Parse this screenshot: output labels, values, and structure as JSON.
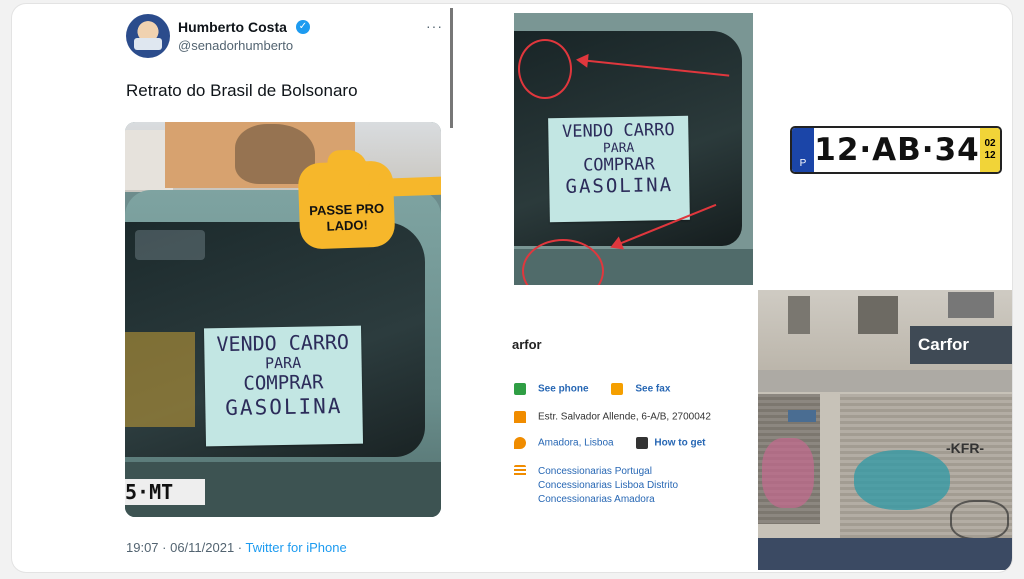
{
  "tweet": {
    "author_name": "Humberto Costa",
    "author_handle": "@senadorhumberto",
    "verified_mark": "✓",
    "more_label": "···",
    "text": "Retrato do Brasil de Bolsonaro",
    "timestamp": "19:07 · 06/11/2021 · ",
    "app": "Twitter for iPhone",
    "overlay_text": "PASSE PRO LADO!"
  },
  "sign": {
    "line1": "VENDO CARRO",
    "line2": "PARA",
    "line3": "COMPRAR",
    "line4": "GASOLINA"
  },
  "car_plate_partial": "5·MT",
  "listing": {
    "name": "arfor",
    "phone": "See phone",
    "fax": "See fax",
    "address": "Estr. Salvador Allende, 6-A/B, 2700042",
    "city": "Amadora, Lisboa",
    "directions": "How to get",
    "categories": [
      "Concessionarias Portugal",
      "Concessionarias Lisboa Distrito",
      "Concessionarias Amadora"
    ]
  },
  "license_plate": {
    "country": "P",
    "number": "12·AB·34",
    "year": "02",
    "month": "12"
  },
  "store": {
    "sign": "Carfor",
    "graffiti": "-KFR-"
  },
  "colors": {
    "link": "#1d9bf0",
    "annotation": "#e0373d",
    "sign_card": "#c2e6e3"
  }
}
